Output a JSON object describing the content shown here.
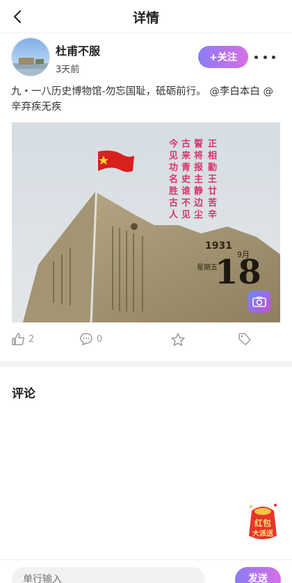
{
  "header": {
    "title": "详情"
  },
  "author": {
    "name": "杜甫不服",
    "time": "3天前"
  },
  "follow": {
    "label": "+关注"
  },
  "post": {
    "text": "九・一八历史博物馆-勿忘国耻，砥砺前行。 @李白本白 @辛弃疾无疾"
  },
  "photo": {
    "poem_lines": [
      "正相勤王廿苦辛",
      "誓将报主静边尘",
      "古来青史谁不见",
      "今见功名胜古人"
    ],
    "monument": {
      "year": "1931",
      "day": "18",
      "month": "9月",
      "weekday": "星期五"
    }
  },
  "actions": {
    "like_count": "2",
    "comment_count": "0"
  },
  "comments": {
    "title": "评论"
  },
  "redpacket": {
    "line1": "红包",
    "line2": "大派送"
  },
  "input": {
    "placeholder": "单行输入",
    "send_label": "发送"
  },
  "colors": {
    "accent_start": "#8a7cf5",
    "accent_end": "#d86ee8",
    "flag": "#d8201c"
  }
}
